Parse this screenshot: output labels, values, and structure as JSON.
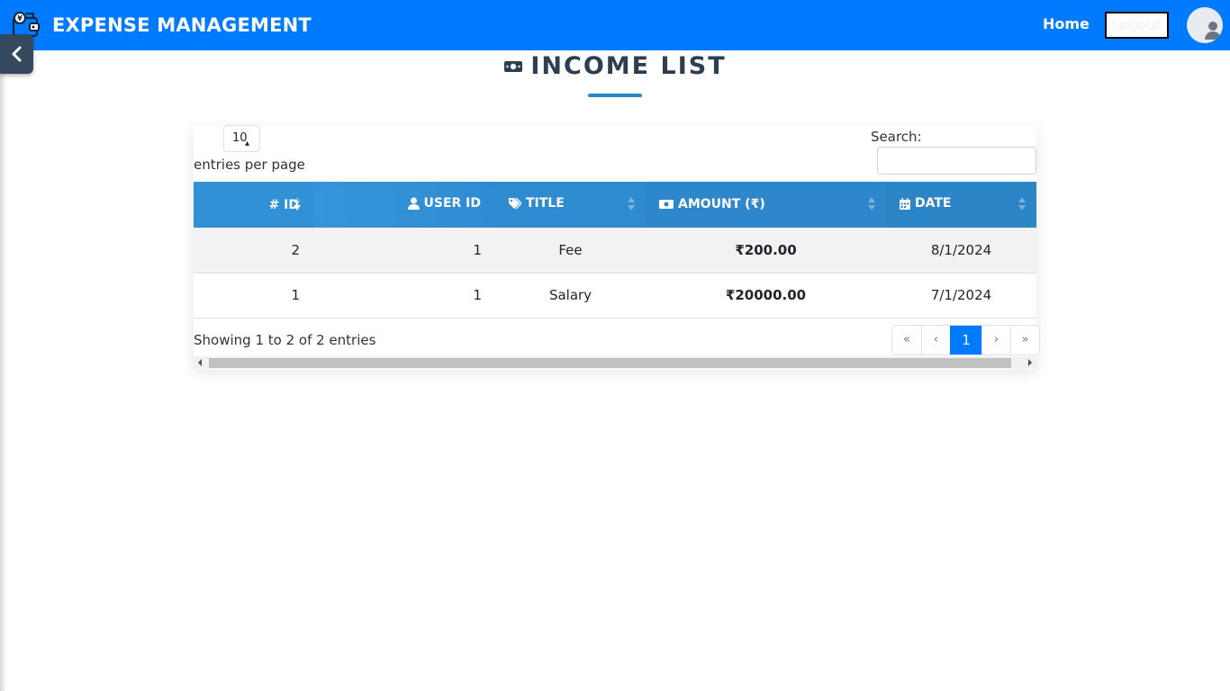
{
  "navbar": {
    "brand": "EXPENSE MANAGEMENT",
    "home": "Home",
    "logout": "Logout",
    "brand_icon": "wallet-icon",
    "avatar_icon": "user-avatar-icon"
  },
  "page": {
    "title": "INCOME LIST",
    "title_icon": "money-bill-icon"
  },
  "table_controls": {
    "page_length": "10",
    "entries_label": "entries per page",
    "search_label": "Search:",
    "search_value": ""
  },
  "table": {
    "headers": {
      "id": "# ID",
      "user_id": "USER ID",
      "title": "TITLE",
      "amount": "AMOUNT (₹)",
      "date": "DATE"
    },
    "header_icons": {
      "user_id": "user-icon",
      "title": "tags-icon",
      "amount": "money-bill-icon",
      "date": "calendar-icon"
    },
    "rows": [
      {
        "id": "2",
        "user_id": "1",
        "title": "Fee",
        "amount": "₹200.00",
        "date": "8/1/2024"
      },
      {
        "id": "1",
        "user_id": "1",
        "title": "Salary",
        "amount": "₹20000.00",
        "date": "7/1/2024"
      }
    ]
  },
  "footer": {
    "info": "Showing 1 to 2 of 2 entries",
    "pagination": {
      "first": "«",
      "prev": "‹",
      "current": "1",
      "next": "›",
      "last": "»"
    }
  },
  "colors": {
    "navbar": "#007bff",
    "header_gradient": "#2e8ad0",
    "heading": "#2c3e50",
    "active_page": "#007bff"
  }
}
